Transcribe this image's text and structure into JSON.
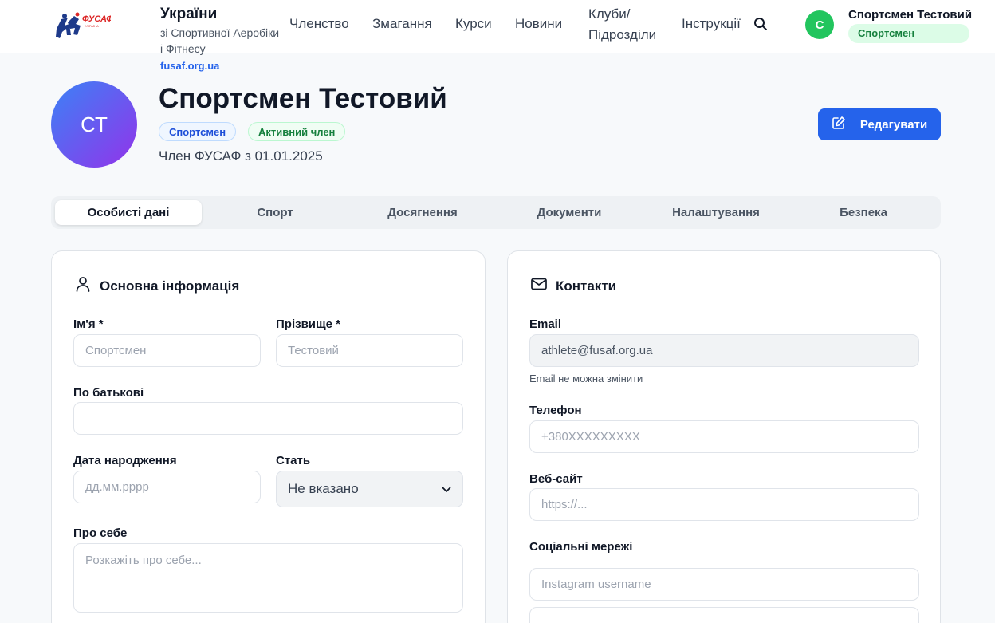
{
  "header": {
    "logo_text": "ФУСАФ",
    "logo_subtext": "УКРАЇНА",
    "org_title": "України",
    "org_subtitle": "зі Спортивної Аеробіки і Фітнесу",
    "org_url": "fusaf.org.ua",
    "nav": {
      "membership": "Членство",
      "competitions": "Змагання",
      "courses": "Курси",
      "news": "Новини",
      "clubs": "Клуби/ Підрозділи",
      "instructions": "Інструкції"
    },
    "user": {
      "initial": "С",
      "name": "Спортсмен Тестовий",
      "role": "Спортсмен"
    }
  },
  "profile": {
    "initials": "СТ",
    "name": "Спортсмен Тестовий",
    "role_badge": "Спортсмен",
    "status_badge": "Активний член",
    "member_since": "Член ФУСАФ з 01.01.2025",
    "edit_label": "Редагувати"
  },
  "tabs": {
    "personal": "Особисті дані",
    "sport": "Спорт",
    "achievements": "Досягнення",
    "documents": "Документи",
    "settings": "Налаштування",
    "security": "Безпека"
  },
  "basic_info": {
    "title": "Основна інформація",
    "first_name_label": "Ім'я *",
    "first_name_placeholder": "Спортсмен",
    "last_name_label": "Прізвище *",
    "last_name_placeholder": "Тестовий",
    "patronymic_label": "По батькові",
    "patronymic_value": "",
    "birthdate_label": "Дата народження",
    "birthdate_placeholder": "дд.мм.рррр",
    "gender_label": "Стать",
    "gender_value": "Не вказано",
    "about_label": "Про себе",
    "about_placeholder": "Розкажіть про себе..."
  },
  "contacts": {
    "title": "Контакти",
    "email_label": "Email",
    "email_value": "athlete@fusaf.org.ua",
    "email_hint": "Email не можна змінити",
    "phone_label": "Телефон",
    "phone_placeholder": "+380XXXXXXXXX",
    "website_label": "Веб-сайт",
    "website_placeholder": "https://...",
    "social_label": "Соціальні мережі",
    "instagram_placeholder": "Instagram username"
  },
  "colors": {
    "accent": "#2563eb",
    "success": "#22c55e",
    "avatar_gradient_start": "#3b82f6",
    "avatar_gradient_end": "#9333ea"
  }
}
